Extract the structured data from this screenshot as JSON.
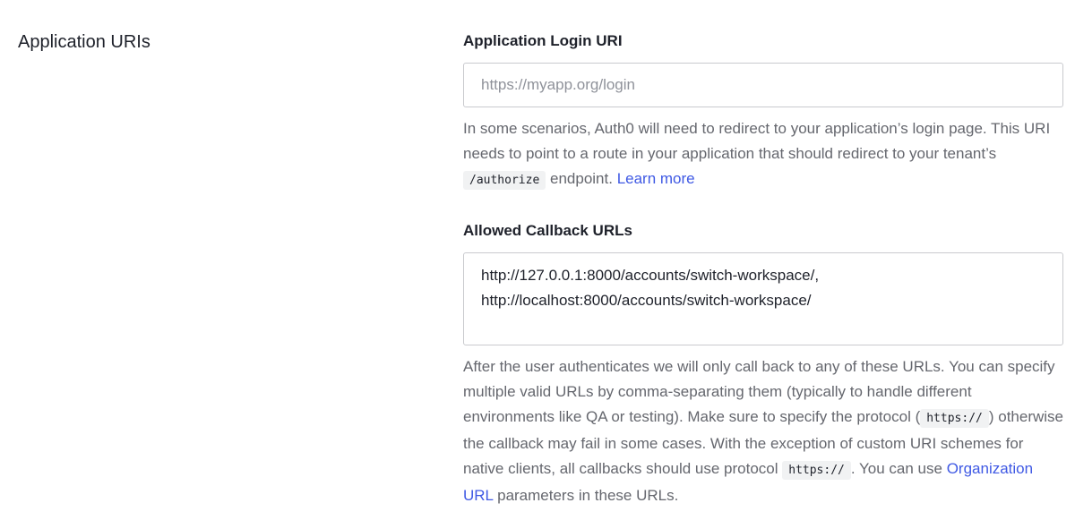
{
  "section": {
    "title": "Application URIs"
  },
  "login_uri": {
    "label": "Application Login URI",
    "placeholder": "https://myapp.org/login",
    "value": "",
    "help_part1": "In some scenarios, Auth0 will need to redirect to your application’s login page. This URI needs to point to a route in your application that should redirect to your tenant’s ",
    "help_code": "/authorize",
    "help_part2": " endpoint. ",
    "help_link": "Learn more"
  },
  "callback_urls": {
    "label": "Allowed Callback URLs",
    "value": "http://127.0.0.1:8000/accounts/switch-workspace/,\nhttp://localhost:8000/accounts/switch-workspace/",
    "help_part1": "After the user authenticates we will only call back to any of these URLs. You can specify multiple valid URLs by comma-separating them (typically to handle different environments like QA or testing). Make sure to specify the protocol (",
    "help_code1": "https://",
    "help_part2": ") otherwise the callback may fail in some cases. With the exception of custom URI schemes for native clients, all callbacks should use protocol ",
    "help_code2": "https://",
    "help_part3": ". You can use ",
    "help_link": "Organization URL",
    "help_part4": " parameters in these URLs."
  },
  "colors": {
    "link": "#3f59e4",
    "text": "#1e212a",
    "muted": "#65676e",
    "border": "#c9cace",
    "code_bg": "#f1f2f3"
  }
}
